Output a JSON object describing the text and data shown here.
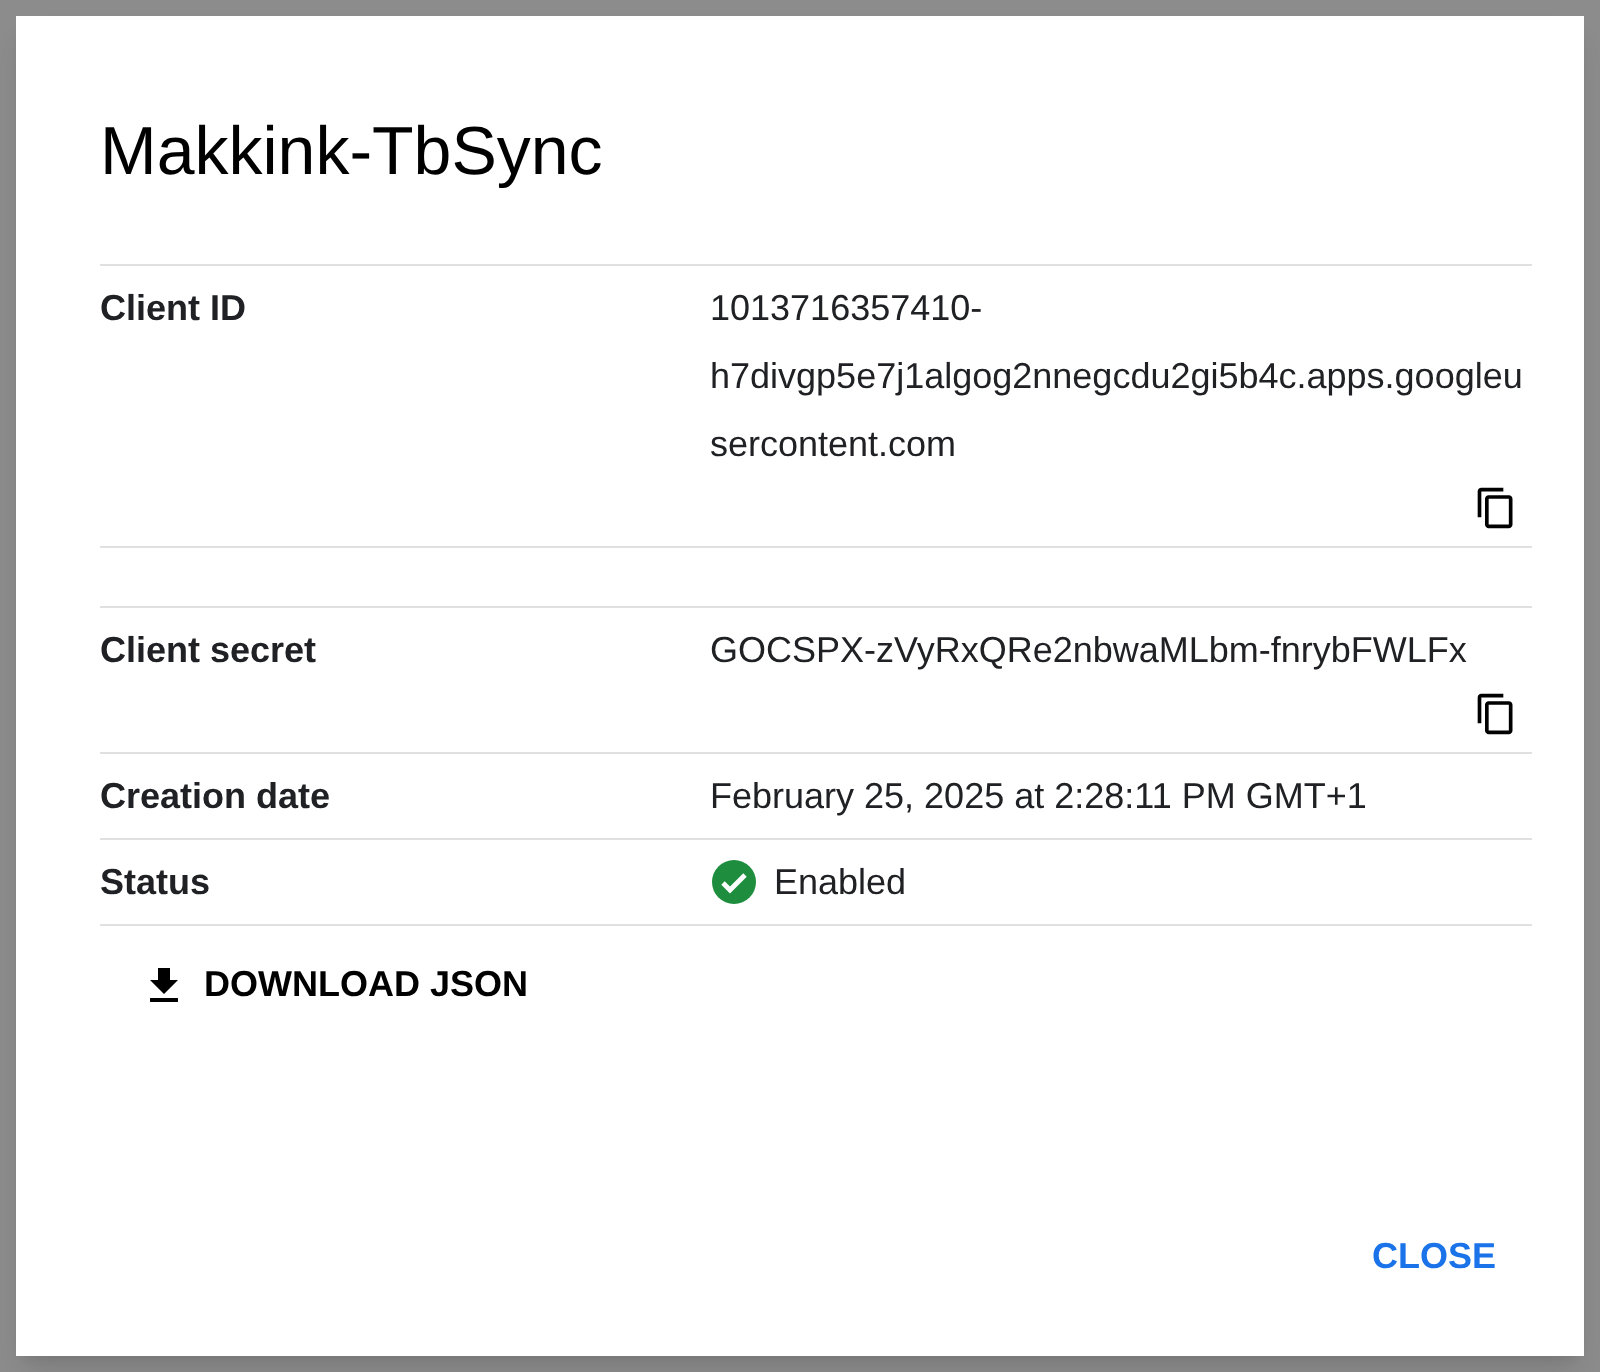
{
  "dialog": {
    "title": "Makkink-TbSync",
    "rows": [
      {
        "kind": "copyable",
        "label": "Client ID",
        "value": "1013716357410-h7divgp5e7j1algog2nnegcdu2gi5b4c.apps.googleusercontent.com"
      },
      {
        "kind": "spacer"
      },
      {
        "kind": "copyable",
        "label": "Client secret",
        "value": "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"
      },
      {
        "kind": "text",
        "label": "Creation date",
        "value": "February 25, 2025 at 2:28:11 PM GMT+1"
      },
      {
        "kind": "status",
        "label": "Status",
        "value": "Enabled",
        "enabled": true
      }
    ],
    "download_button": "DOWNLOAD JSON",
    "close_button": "CLOSE"
  }
}
